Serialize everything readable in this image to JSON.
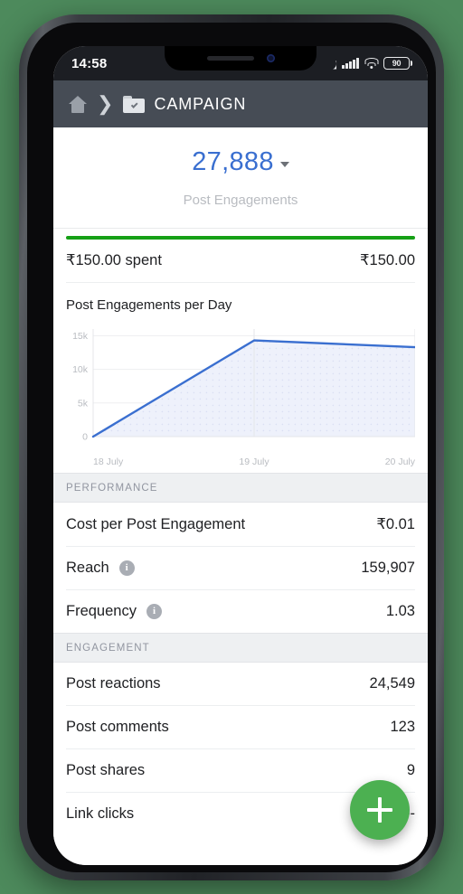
{
  "status_bar": {
    "time": "14:58",
    "dnd_icon": "crescent-moon-icon",
    "signal_icon": "cellular-signal-icon",
    "wifi_icon": "wifi-icon",
    "battery_level": "90"
  },
  "app_bar": {
    "home_icon": "home-icon",
    "separator": "❯",
    "folder_icon": "folder-check-icon",
    "title": "CAMPAIGN"
  },
  "headline": {
    "value": "27,888",
    "label": "Post Engagements",
    "dropdown_icon": "chevron-down-icon"
  },
  "budget": {
    "spent_label": "₹150.00 spent",
    "total": "₹150.00",
    "progress_percent": 100,
    "bar_color": "#16a016"
  },
  "chart_data": {
    "type": "area",
    "title": "Post Engagements per Day",
    "x": [
      "18 July",
      "19 July",
      "20 July"
    ],
    "values": [
      0,
      14300,
      13300
    ],
    "categories": [
      "18 July",
      "19 July",
      "20 July"
    ],
    "series": [
      {
        "name": "Post Engagements per Day",
        "values": [
          0,
          14300,
          13300
        ]
      }
    ],
    "ylim": [
      0,
      16000
    ],
    "yticks": [
      0,
      5000,
      10000,
      15000
    ],
    "ytick_labels": [
      "0",
      "5k",
      "10k",
      "15k"
    ],
    "xlabel": "",
    "ylabel": "",
    "grid": true,
    "legend": "none",
    "line_color": "#3a6fd0",
    "fill_color": "#eef1fb"
  },
  "performance": {
    "header": "PERFORMANCE",
    "rows": [
      {
        "label": "Cost per Post Engagement",
        "value": "₹0.01",
        "info": false
      },
      {
        "label": "Reach",
        "value": "159,907",
        "info": true
      },
      {
        "label": "Frequency",
        "value": "1.03",
        "info": true
      }
    ]
  },
  "engagement": {
    "header": "ENGAGEMENT",
    "rows": [
      {
        "label": "Post reactions",
        "value": "24,549"
      },
      {
        "label": "Post comments",
        "value": "123"
      },
      {
        "label": "Post shares",
        "value": "9"
      },
      {
        "label": "Link clicks",
        "value": "--"
      }
    ]
  },
  "fab": {
    "icon": "plus-icon",
    "label": "+",
    "color": "#4cb051"
  }
}
